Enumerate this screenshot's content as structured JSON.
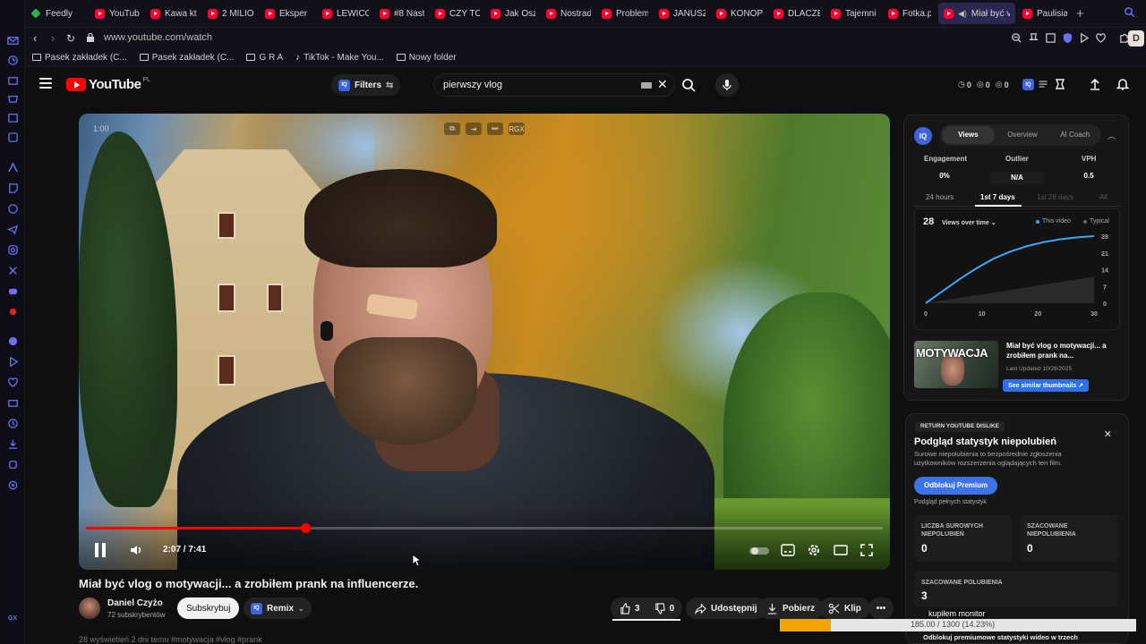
{
  "browser": {
    "tabs": [
      {
        "label": "Feedly",
        "icon": "feedly-icon"
      },
      {
        "label": "YouTube",
        "icon": "youtube-icon"
      },
      {
        "label": "Kawa kt",
        "icon": "youtube-icon"
      },
      {
        "label": "2 MILIO",
        "icon": "youtube-icon"
      },
      {
        "label": "Eksper",
        "icon": "youtube-icon"
      },
      {
        "label": "LEWICO",
        "icon": "youtube-icon"
      },
      {
        "label": "#8 Nast",
        "icon": "youtube-icon"
      },
      {
        "label": "CZY TO",
        "icon": "youtube-icon"
      },
      {
        "label": "Jak Osz",
        "icon": "youtube-icon"
      },
      {
        "label": "Nostrad",
        "icon": "youtube-icon"
      },
      {
        "label": "Problem",
        "icon": "youtube-icon"
      },
      {
        "label": "JANUSZ",
        "icon": "youtube-icon"
      },
      {
        "label": "KONOPI",
        "icon": "youtube-icon"
      },
      {
        "label": "DLACZE",
        "icon": "youtube-icon"
      },
      {
        "label": "Tajemni",
        "icon": "youtube-icon"
      },
      {
        "label": "Fotka.pl",
        "icon": "youtube-icon"
      },
      {
        "label": "Miał być vlog",
        "icon": "youtube-icon",
        "active": true
      },
      {
        "label": "Paulisia",
        "icon": "youtube-icon"
      }
    ],
    "url": "www.youtube.com/watch",
    "profile_initial": "D",
    "bookmarks": [
      {
        "label": "Pasek zakładek (C...",
        "icon": "folder-icon"
      },
      {
        "label": "Pasek zakładek (C...",
        "icon": "folder-icon"
      },
      {
        "label": "G R A",
        "icon": "folder-icon"
      },
      {
        "label": "TikTok - Make You...",
        "icon": "tiktok-icon"
      },
      {
        "label": "Nowy folder",
        "icon": "folder-icon"
      }
    ]
  },
  "youtube": {
    "logo_text": "YouTube",
    "logo_region": "PL",
    "filters_label": "Filters",
    "iq_badge": "IQ",
    "search_value": "pierwszy vlog",
    "header_stats": [
      "0",
      "0",
      "0"
    ]
  },
  "video": {
    "overlay_time": "1:00",
    "top_controls": [
      "pip",
      "exit",
      "skip",
      "RGX"
    ],
    "current_time": "2:07 / 7:41",
    "progress_fraction": 0.275,
    "title": "Miał być vlog o motywacji... a zrobiłem prank na influencerze.",
    "channel_name": "Daniel Czyżo",
    "channel_subs": "72 subskrybentów",
    "subscribe_label": "Subskrybuj",
    "remix_label": "Remix",
    "likes": "3",
    "dislikes": "0",
    "share_label": "Udostępnij",
    "download_label": "Pobierz",
    "clip_label": "Klip",
    "below_text": "28 wyświetleń  2 dni temu  #motywacja #vlog #prank"
  },
  "vidiq": {
    "logo": "IQ",
    "tabs": [
      "Views",
      "Overview",
      "AI Coach"
    ],
    "metrics": [
      {
        "label": "Engagement",
        "value": "0%"
      },
      {
        "label": "Outlier",
        "value": "N/A"
      },
      {
        "label": "VPH",
        "value": "0.5"
      }
    ],
    "ranges": [
      "24 hours",
      "1st 7 days",
      "1st 28 days",
      "All"
    ],
    "views_total": "28",
    "views_over_time": "Views over time",
    "legend_this": "This video",
    "legend_typical": "Typical",
    "thumb_text": "MOTYWACJA",
    "video_title": "Miał być vlog o motywacji... a zrobiłem prank na...",
    "last_updated": "Last Updated 10/26/2025",
    "similar_btn": "See similar thumbnails ↗"
  },
  "chart_data": {
    "type": "area",
    "title": "Views over time",
    "x_ticks": [
      0,
      10,
      20,
      30
    ],
    "y_ticks": [
      0,
      7,
      14,
      21,
      28
    ],
    "xlim": [
      0,
      30
    ],
    "ylim": [
      0,
      28
    ],
    "grid": false,
    "legend_placement": "top-right",
    "series": [
      {
        "name": "This video",
        "color": "#3ea6ff",
        "x": [
          0,
          3,
          6,
          9,
          12,
          15,
          18,
          21,
          24,
          27,
          30
        ],
        "y": [
          0,
          5,
          10,
          14.5,
          18.5,
          21.5,
          23.8,
          25.5,
          26.7,
          27.5,
          28
        ]
      },
      {
        "name": "Typical",
        "color": "#555555",
        "x": [
          0,
          30
        ],
        "y": [
          0,
          11
        ]
      }
    ]
  },
  "ryd": {
    "tag": "RETURN YOUTUBE DISLIKE",
    "title": "Podgląd statystyk niepolubień",
    "description": "Surowe niepolubienia to bezpośrednie zgłoszenia użytkowników rozszerzenia oglądających ten film.",
    "unlock_label": "Odblokuj Premium",
    "preview_label": "Podgląd pełnych statystyk",
    "cards": [
      {
        "label": "LICZBA SUROWYCH NIEPOLUBIEŃ",
        "value": "0"
      },
      {
        "label": "SZACOWANE NIEPOLUBIENIA",
        "value": "0"
      },
      {
        "label": "SZACOWANE POLUBIENIA",
        "value": "3"
      }
    ],
    "footer": "Odblokuj premiumowe statystyki wideo w trzech"
  },
  "download": {
    "label": "kupiłem monitor",
    "progress_text": "185.00 / 1300 (14.23%)",
    "fraction": 0.1423
  },
  "colors": {
    "accent": "#3ea6ff",
    "youtube_red": "#ff0000",
    "vidiq_blue": "#3d63dd",
    "download_orange": "#f0a500"
  }
}
